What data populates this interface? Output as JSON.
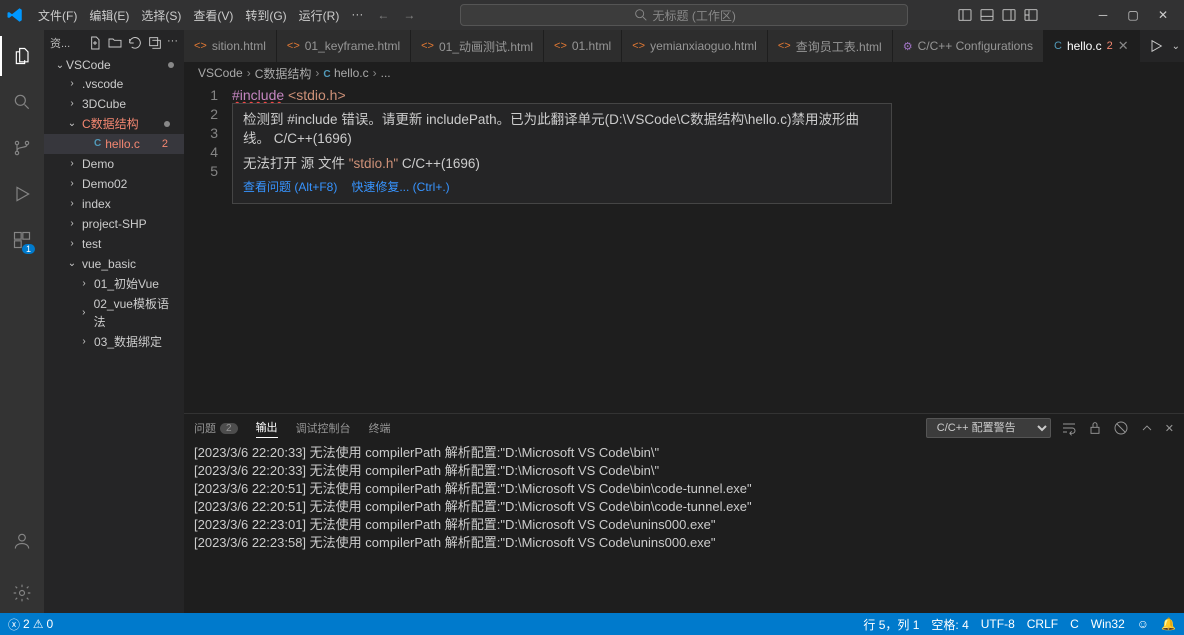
{
  "titlebar": {
    "menus": [
      "文件(F)",
      "编辑(E)",
      "选择(S)",
      "查看(V)",
      "转到(G)",
      "运行(R)",
      "···"
    ],
    "searchPlaceholder": "无标题 (工作区)"
  },
  "sidebar": {
    "headerLabel": "资...",
    "root": "VSCode",
    "items": [
      {
        "label": ".vscode",
        "depth": 1,
        "chev": "›"
      },
      {
        "label": "3DCube",
        "depth": 1,
        "chev": "›"
      },
      {
        "label": "C数据结构",
        "depth": 1,
        "chev": "⌄",
        "error": true,
        "dot": true
      },
      {
        "label": "hello.c",
        "depth": 2,
        "icon": "C",
        "active": true,
        "error": true,
        "badge": "2"
      },
      {
        "label": "Demo",
        "depth": 1,
        "chev": "›"
      },
      {
        "label": "Demo02",
        "depth": 1,
        "chev": "›"
      },
      {
        "label": "index",
        "depth": 1,
        "chev": "›"
      },
      {
        "label": "project-SHP",
        "depth": 1,
        "chev": "›"
      },
      {
        "label": "test",
        "depth": 1,
        "chev": "›"
      },
      {
        "label": "vue_basic",
        "depth": 1,
        "chev": "⌄"
      },
      {
        "label": "01_初始Vue",
        "depth": 2,
        "chev": "›"
      },
      {
        "label": "02_vue模板语法",
        "depth": 2,
        "chev": "›"
      },
      {
        "label": "03_数据绑定",
        "depth": 2,
        "chev": "›"
      }
    ]
  },
  "tabs": [
    {
      "label": "sition.html",
      "icon": "<>"
    },
    {
      "label": "01_keyframe.html",
      "icon": "<>"
    },
    {
      "label": "01_动画测试.html",
      "icon": "<>"
    },
    {
      "label": "01.html",
      "icon": "<>"
    },
    {
      "label": "yemianxiaoguo.html",
      "icon": "<>"
    },
    {
      "label": "查询员工表.html",
      "icon": "<>"
    },
    {
      "label": "C/C++ Configurations",
      "icon": "⚙"
    },
    {
      "label": "hello.c",
      "icon": "C",
      "active": true,
      "badge": "2",
      "close": true
    }
  ],
  "breadcrumb": [
    "VSCode",
    "C数据结构",
    "hello.c",
    "..."
  ],
  "code": {
    "lines": [
      "1",
      "2",
      "3",
      "4",
      "5"
    ],
    "line1_a": "#include",
    "line1_b": "<stdio.h>"
  },
  "hover": {
    "l1a": "检测到 ",
    "l1b": "#include",
    "l1c": " 错误。请更新 ",
    "l1d": "includePath",
    "l1e": "。已为此翻译单元(D:\\VSCode\\C数据结构\\hello.c)禁用波形曲线。 C/C++(1696)",
    "l2a": "无法打开 源 文件 ",
    "l2b": "\"stdio.h\"",
    "l2c": " C/C++(1696)",
    "link1": "查看问题 (Alt+F8)",
    "link2": "快速修复... (Ctrl+.)"
  },
  "panel": {
    "tabs": {
      "problems": "问题",
      "problemsCount": "2",
      "output": "输出",
      "debug": "调试控制台",
      "terminal": "终端"
    },
    "filter": "C/C++ 配置警告",
    "lines": [
      "[2023/3/6 22:20:33] 无法使用 compilerPath 解析配置:\"D:\\Microsoft VS Code\\bin\\\"",
      "[2023/3/6 22:20:33] 无法使用 compilerPath 解析配置:\"D:\\Microsoft VS Code\\bin\\\"",
      "[2023/3/6 22:20:51] 无法使用 compilerPath 解析配置:\"D:\\Microsoft VS Code\\bin\\code-tunnel.exe\"",
      "[2023/3/6 22:20:51] 无法使用 compilerPath 解析配置:\"D:\\Microsoft VS Code\\bin\\code-tunnel.exe\"",
      "[2023/3/6 22:23:01] 无法使用 compilerPath 解析配置:\"D:\\Microsoft VS Code\\unins000.exe\"",
      "[2023/3/6 22:23:58] 无法使用 compilerPath 解析配置:\"D:\\Microsoft VS Code\\unins000.exe\""
    ]
  },
  "statusbar": {
    "errors": "2",
    "warnings": "0",
    "pos": "行 5，列 1",
    "spaces": "空格: 4",
    "enc": "UTF-8",
    "eol": "CRLF",
    "lang": "C",
    "target": "Win32"
  }
}
